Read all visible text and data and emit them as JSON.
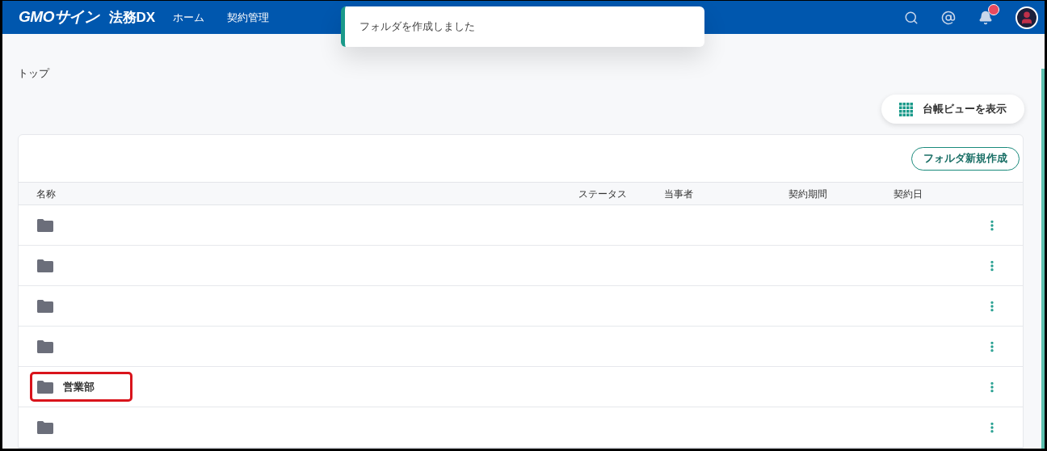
{
  "header": {
    "logo": "GMOサイン",
    "product": "法務DX",
    "nav": [
      {
        "label": "ホーム"
      },
      {
        "label": "契約管理"
      }
    ],
    "notification_badge": true
  },
  "toast": {
    "message": "フォルダを作成しました"
  },
  "breadcrumb": "トップ",
  "ledger_button": "台帳ビューを表示",
  "new_folder_button": "フォルダ新規作成",
  "table": {
    "columns": [
      "名称",
      "ステータス",
      "当事者",
      "契約期間",
      "契約日"
    ],
    "rows": [
      {
        "name": "",
        "highlighted": false
      },
      {
        "name": "",
        "highlighted": false
      },
      {
        "name": "",
        "highlighted": false
      },
      {
        "name": "",
        "highlighted": false
      },
      {
        "name": "営業部",
        "highlighted": true
      },
      {
        "name": "",
        "highlighted": false
      }
    ]
  }
}
